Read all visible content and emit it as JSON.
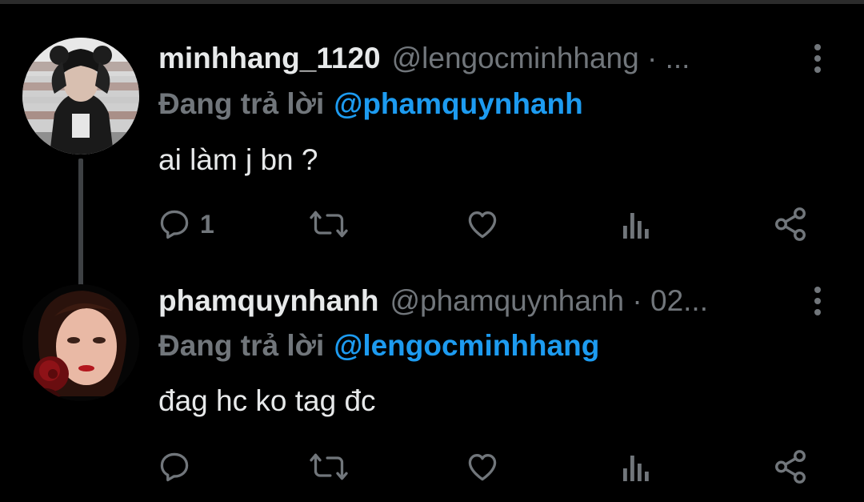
{
  "tweets": [
    {
      "display_name": "minhhang_1120",
      "handle": "@lengocminhhang · ...",
      "reply_prefix": "Đang trả lời",
      "reply_to": "@phamquynhanh",
      "text": "ai làm j bn ?",
      "reply_count": "1",
      "retweet_count": "",
      "like_count": ""
    },
    {
      "display_name": "phamquynhanh",
      "handle": "@phamquynhanh · 02...",
      "reply_prefix": "Đang trả lời",
      "reply_to": "@lengocminhhang",
      "text": "đag hc ko tag đc",
      "reply_count": "",
      "retweet_count": "",
      "like_count": ""
    }
  ],
  "icons": {
    "reply": "reply-icon",
    "retweet": "retweet-icon",
    "like": "heart-icon",
    "views": "views-icon",
    "share": "share-icon",
    "more": "more-vertical-icon"
  },
  "colors": {
    "background": "#000000",
    "text": "#e7e9ea",
    "secondary": "#71767b",
    "link": "#1d9bf0",
    "thread_line": "#3e4144"
  }
}
